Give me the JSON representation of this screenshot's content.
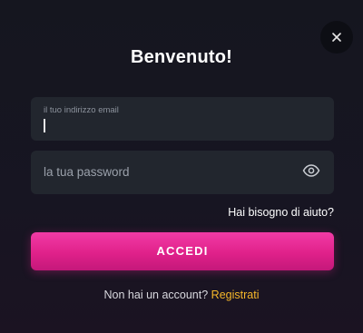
{
  "modal": {
    "title": "Benvenuto!",
    "close_icon": "close-icon"
  },
  "form": {
    "email": {
      "label": "il tuo indirizzo email",
      "value": ""
    },
    "password": {
      "placeholder": "la tua password",
      "value": "",
      "toggle_icon": "eye-icon"
    },
    "help_link": "Hai bisogno di aiuto?",
    "submit_label": "ACCEDI"
  },
  "footer": {
    "prompt": "Non hai un account?",
    "register_link": "Registrati"
  },
  "colors": {
    "accent_pink": "#e0218a",
    "link_yellow": "#f5b72a",
    "field_bg": "#22262e",
    "modal_bg": "#15161f"
  }
}
